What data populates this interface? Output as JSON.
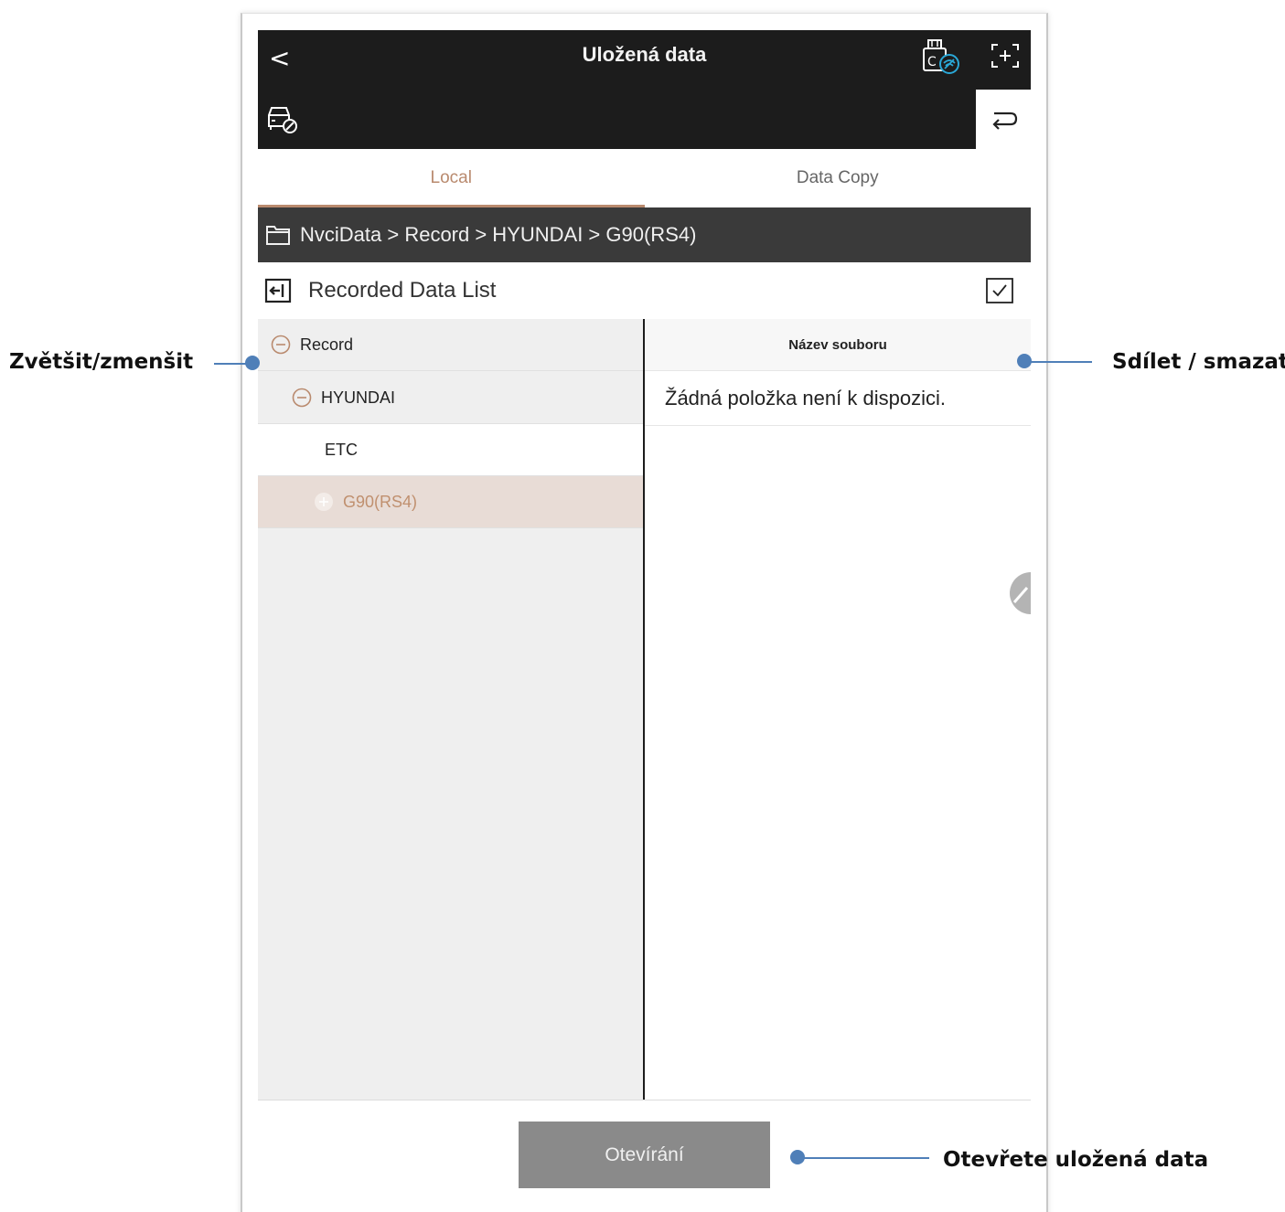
{
  "header": {
    "back_label": "<",
    "title": "Uložená data"
  },
  "tabs": [
    {
      "label": "Local",
      "active": true
    },
    {
      "label": "Data Copy",
      "active": false
    }
  ],
  "path": "NvciData > Record > HYUNDAI > G90(RS4)",
  "list_header": {
    "title": "Recorded Data List"
  },
  "tree": [
    {
      "label": "Record",
      "icon": "minus-circle-icon"
    },
    {
      "label": "HYUNDAI",
      "icon": "minus-circle-icon"
    },
    {
      "label": "ETC",
      "icon": ""
    },
    {
      "label": "G90(RS4)",
      "icon": "plus-circle-icon",
      "selected": true
    }
  ],
  "files": {
    "column_header": "Název souboru",
    "empty_message": "Žádná položka není k dispozici."
  },
  "footer": {
    "open_button": "Otevírání"
  },
  "callouts": {
    "left": "Zvětšit/zmenšit",
    "right": "Sdílet / smazat",
    "bottom": "Otevřete uložená data"
  },
  "colors": {
    "accent": "#b98a6e",
    "title_bar": "#1c1c1c",
    "path_bar": "#3a3a3a",
    "selected_row": "#e8dcd6",
    "callout": "#4f7fb8",
    "button": "#8a8a8a"
  }
}
